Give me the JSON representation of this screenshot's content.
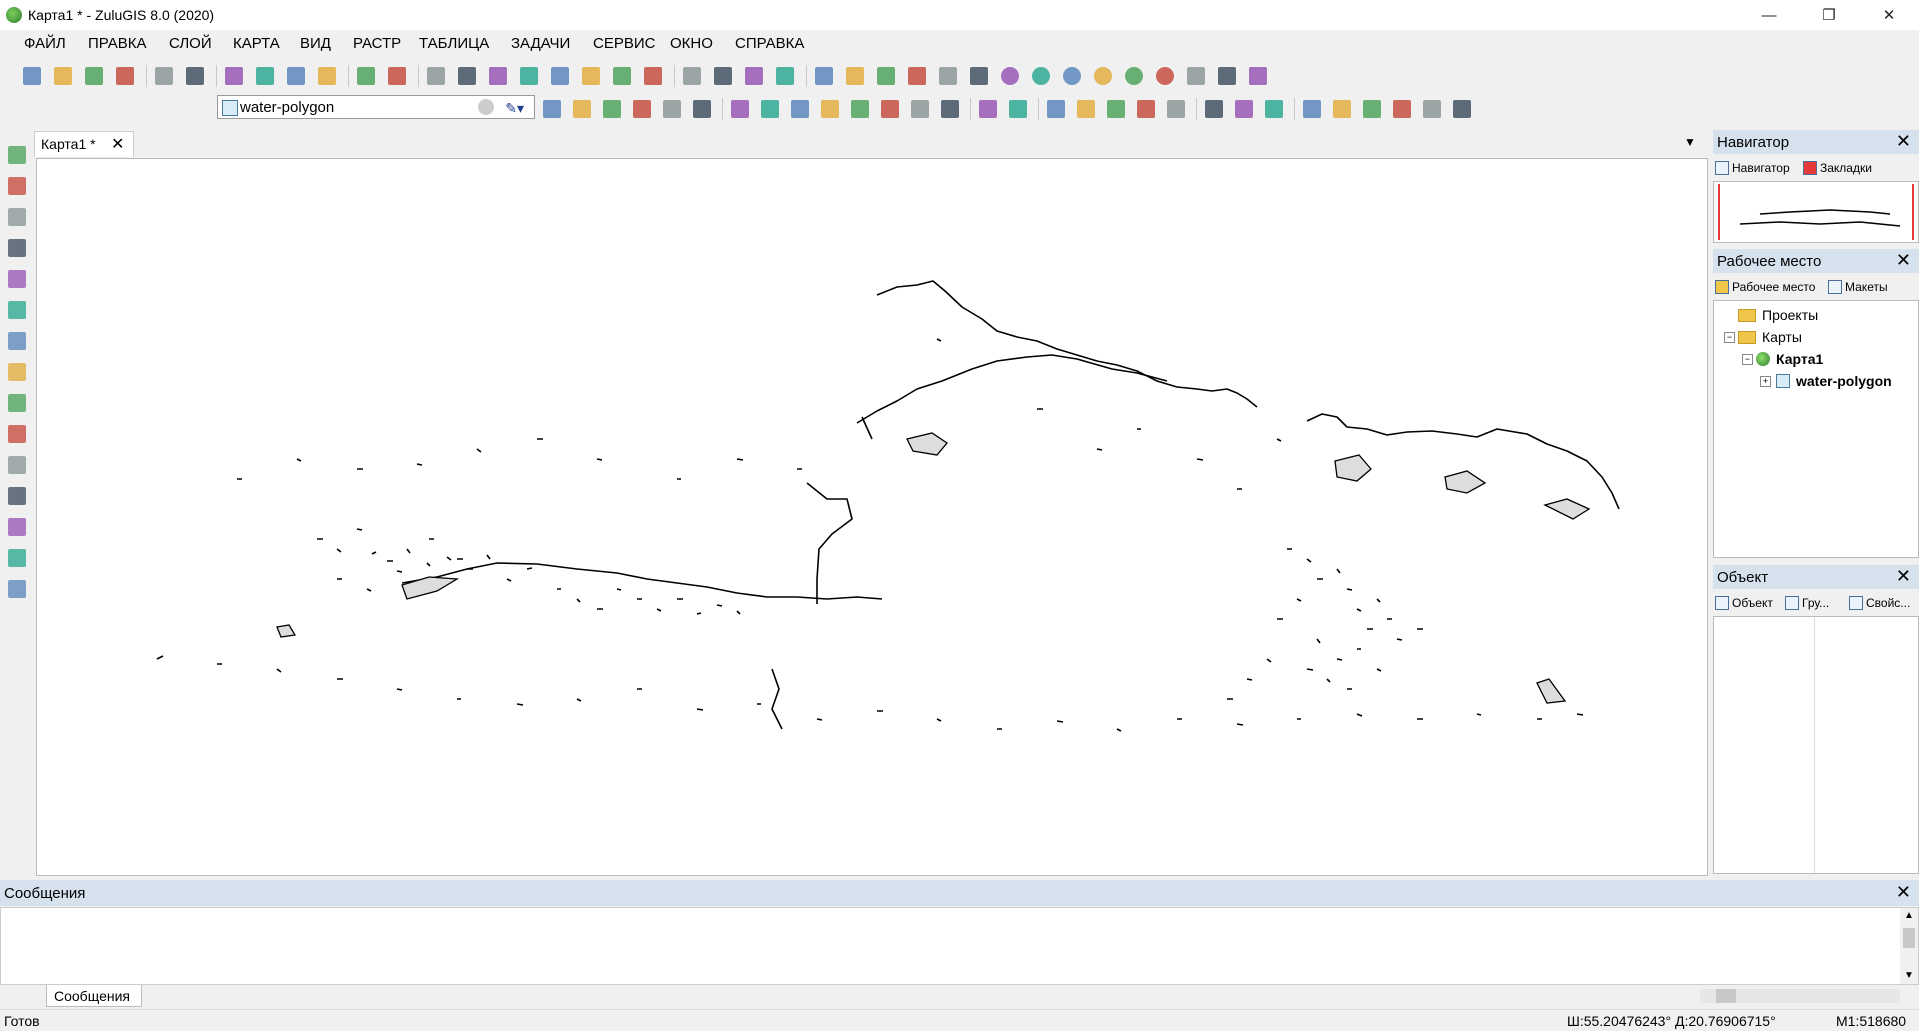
{
  "window": {
    "title": "Карта1 * - ZuluGIS 8.0 (2020)",
    "minimize": "—",
    "restore": "❐",
    "close": "✕"
  },
  "menu": [
    "ФАЙЛ",
    "ПРАВКА",
    "СЛОЙ",
    "КАРТА",
    "ВИД",
    "РАСТР",
    "ТАБЛИЦА",
    "ЗАДАЧИ",
    "СЕРВИС",
    "ОКНО",
    "СПРАВКА"
  ],
  "layer_combo": {
    "value": "water-polygon"
  },
  "map_tab": {
    "label": "Карта1 *",
    "close": "✕"
  },
  "toolbar1_icons": [
    "new-file-icon",
    "open-file-icon",
    "save-icon",
    "print-icon",
    "print-preview-icon",
    "export-icon",
    "cut-icon",
    "copy-icon",
    "paste-icon",
    "delete-icon",
    "undo-icon",
    "redo-icon",
    "layer-props-icon",
    "layer-list-icon",
    "window-icon",
    "add-layer-icon",
    "edit-icon",
    "table-icon",
    "search-icon",
    "help-icon",
    "doc-icon",
    "doc2-icon",
    "select-doc-icon",
    "grid-icon",
    "net-icon",
    "net2-icon",
    "chart-icon",
    "chart2-icon",
    "chart3-icon",
    "chart4-icon",
    "d-icon",
    "g-icon",
    "h-icon",
    "opc-icon",
    "s-icon",
    "t-icon",
    "play-icon",
    "pause-icon",
    "graph-icon"
  ],
  "toolbar2_icons": [
    "add-layer-icon",
    "remove-layer-icon",
    "layer-settings-icon",
    "layer-edit-icon",
    "layer-copy-icon",
    "layer-raster-icon",
    "select-tool-icon",
    "filter-tool-icon",
    "node-icon",
    "db-icon",
    "db2-icon",
    "share-icon",
    "split-icon",
    "marker-icon",
    "back-icon",
    "forward-icon",
    "draw-line-icon",
    "move-icon",
    "rotate-icon",
    "copy-obj-icon",
    "union-icon",
    "tag-icon",
    "scale-icon",
    "scale2-icon",
    "shape1-icon",
    "shape2-icon",
    "shape3-icon",
    "shape4-icon",
    "shape5-icon",
    "cross-icon"
  ],
  "left_tools": [
    "select-arrow-icon",
    "select-rect-icon",
    "select-lasso-icon",
    "select-poly-icon",
    "refresh-icon",
    "full-extent-icon",
    "zoom-in-icon",
    "zoom-out-icon",
    "pan-hand-icon",
    "info-icon",
    "binoculars-icon",
    "navigate-icon",
    "measure-icon",
    "filter-icon",
    "filter-off-icon"
  ],
  "panels": {
    "navigator": {
      "title": "Навигатор",
      "tabs": [
        "Навигатор",
        "Закладки"
      ]
    },
    "workspace": {
      "title": "Рабочее место",
      "tabs": [
        "Рабочее место",
        "Макеты"
      ],
      "tree": [
        "Проекты",
        "Карты",
        "Карта1",
        "water-polygon"
      ]
    },
    "object": {
      "title": "Объект",
      "tabs": [
        "Объект",
        "Гру...",
        "Свойс..."
      ]
    }
  },
  "messages": {
    "title": "Сообщения",
    "tab": "Сообщения"
  },
  "status": {
    "ready": "Готов",
    "coords": "Ш:55.20476243° Д:20.76906715°",
    "scale": "M1:518680"
  },
  "colors": {
    "panel_header": "#d5e2ee",
    "accent": "#1f5fa8"
  }
}
